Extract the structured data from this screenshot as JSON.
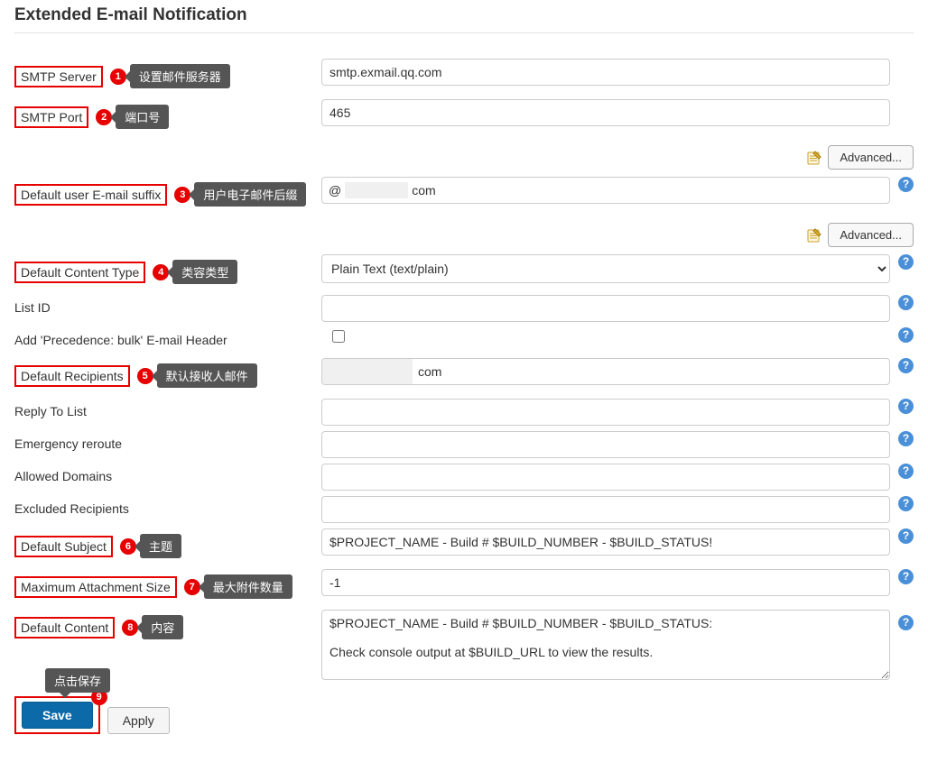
{
  "section_title": "Extended E-mail Notification",
  "advanced_btn": "Advanced...",
  "help_glyph": "?",
  "annotations": {
    "a1": "设置邮件服务器",
    "a2": "端口号",
    "a3": "用户电子邮件后缀",
    "a4": "类容类型",
    "a5": "默认接收人邮件",
    "a6": "主题",
    "a7": "最大附件数量",
    "a8": "内容",
    "a9": "点击保存"
  },
  "labels": {
    "smtp_server": "SMTP Server",
    "smtp_port": "SMTP Port",
    "default_suffix": "Default user E-mail suffix",
    "default_content_type": "Default Content Type",
    "list_id": "List ID",
    "precedence_bulk": "Add 'Precedence: bulk' E-mail Header",
    "default_recipients": "Default Recipients",
    "reply_to_list": "Reply To List",
    "emergency_reroute": "Emergency reroute",
    "allowed_domains": "Allowed Domains",
    "excluded_recipients": "Excluded Recipients",
    "default_subject": "Default Subject",
    "max_attach_size": "Maximum Attachment Size",
    "default_content": "Default Content"
  },
  "values": {
    "smtp_server": "smtp.exmail.qq.com",
    "smtp_port": "465",
    "default_suffix_visible_tail": "com",
    "default_suffix_at": "@",
    "content_type_selected": "Plain Text (text/plain)",
    "list_id": "",
    "precedence_bulk_checked": false,
    "default_recipients_visible_tail": "com",
    "reply_to_list": "",
    "emergency_reroute": "",
    "allowed_domains": "",
    "excluded_recipients": "",
    "default_subject": "$PROJECT_NAME - Build # $BUILD_NUMBER - $BUILD_STATUS!",
    "max_attach_size": "-1",
    "default_content": "$PROJECT_NAME - Build # $BUILD_NUMBER - $BUILD_STATUS:\n\nCheck console output at $BUILD_URL to view the results."
  },
  "buttons": {
    "save": "Save",
    "apply": "Apply"
  }
}
